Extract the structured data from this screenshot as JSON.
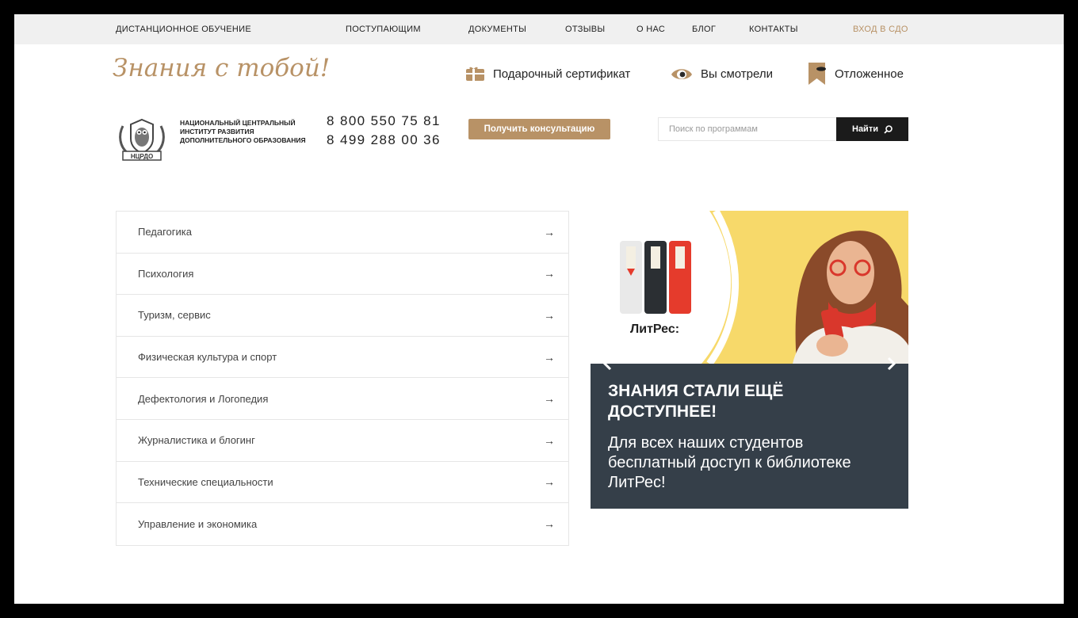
{
  "topnav": {
    "items": [
      "ДИСТАНЦИОННОЕ ОБУЧЕНИЕ",
      "ПОСТУПАЮЩИМ",
      "ДОКУМЕНТЫ",
      "ОТЗЫВЫ",
      "О НАС",
      "БЛОГ",
      "КОНТАКТЫ"
    ],
    "login": "ВХОД В СДО"
  },
  "slogan": "Знания с тобой!",
  "utilities": {
    "gift": "Подарочный сертификат",
    "viewed": "Вы смотрели",
    "saved": "Отложенное"
  },
  "logo": {
    "emblem_text": "НЦРДО",
    "name": "НАЦИОНАЛЬНЫЙ ЦЕНТРАЛЬНЫЙ ИНСТИТУТ РАЗВИТИЯ ДОПОЛНИТЕЛЬНОГО ОБРАЗОВАНИЯ"
  },
  "phones": [
    "8 800 550 75 81",
    "8 499 288 00 36"
  ],
  "consult_button": "Получить консультацию",
  "search": {
    "placeholder": "Поиск по программам",
    "button": "Найти"
  },
  "categories": [
    "Педагогика",
    "Психология",
    "Туризм, сервис",
    "Физическая культура и спорт",
    "Дефектология и Логопедия",
    "Журналистика и блогинг",
    "Технические специальности",
    "Управление и экономика"
  ],
  "banner": {
    "brand": "ЛитРес:",
    "title": "ЗНАНИЯ СТАЛИ ЕЩЁ ДОСТУПНЕЕ!",
    "text": "Для всех наших студентов бесплатный доступ к библиотеке ЛитРес!"
  },
  "colors": {
    "accent": "#b89266",
    "dark": "#353f49",
    "nav_bg": "#f0f0f0",
    "banner_yellow": "#f7d96a"
  }
}
